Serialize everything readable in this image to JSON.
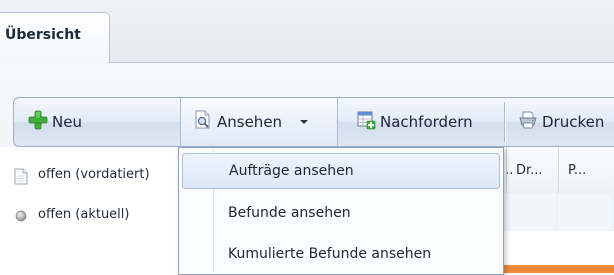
{
  "tabs": [
    {
      "label": "Übersicht"
    }
  ],
  "toolbar": {
    "new_label": "Neu",
    "view_label": "Ansehen",
    "request_label": "Nachfordern",
    "print_label": "Drucken"
  },
  "view_menu": {
    "items": [
      {
        "label": "Aufträge ansehen"
      },
      {
        "label": "Befunde ansehen"
      },
      {
        "label": "Kumulierte Befunde ansehen"
      }
    ]
  },
  "grid": {
    "columns": [
      "...",
      "Dr...",
      "P..."
    ],
    "rows": [
      {
        "label": "offen (vordatiert)",
        "icon": "document-icon"
      },
      {
        "label": "offen (aktuell)",
        "icon": "status-dot-icon"
      }
    ]
  },
  "colors": {
    "accent_orange": "#f08a3a",
    "toolbar_border": "#9ab0cc",
    "menu_hover": "#dde8f7"
  }
}
